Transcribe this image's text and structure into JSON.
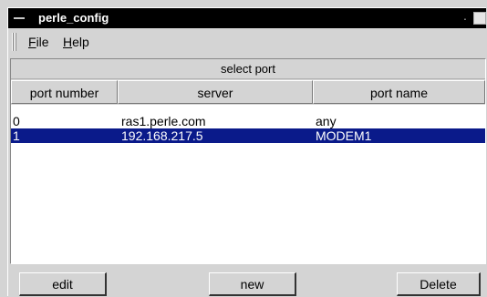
{
  "window": {
    "title": "perle_config",
    "minimize_glyph": "·",
    "menu_icon": "window-menu-icon",
    "maximize_icon": "maximize-icon"
  },
  "menubar": {
    "items": [
      {
        "mnemonic": "F",
        "rest": "ile"
      },
      {
        "mnemonic": "H",
        "rest": "elp"
      }
    ]
  },
  "panel": {
    "title": "select port",
    "columns": [
      "port number",
      "server",
      "port name"
    ],
    "rows": [
      {
        "port_number": "0",
        "server": "ras1.perle.com",
        "port_name": "any",
        "selected": false
      },
      {
        "port_number": "1",
        "server": "192.168.217.5",
        "port_name": "MODEM1",
        "selected": true
      }
    ]
  },
  "buttons": {
    "edit": "edit",
    "new": "new",
    "delete": "Delete"
  },
  "colors": {
    "selection": "#0a1a8a",
    "titlebar": "#000000"
  }
}
